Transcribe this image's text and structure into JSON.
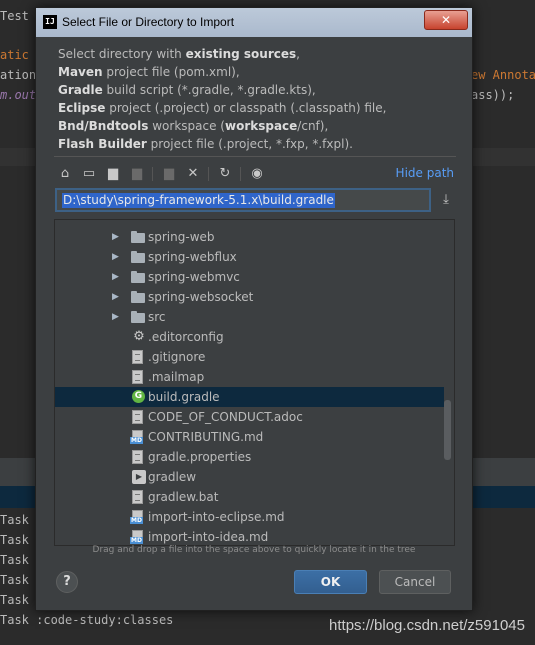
{
  "background": {
    "code_lines": [
      "Test",
      "atic",
      "ation",
      "m.out",
      "ew Annota",
      "ass));"
    ],
    "task_lines": [
      "Task",
      "Task",
      "Task",
      "Task",
      "Task",
      "Task :code-study:classes"
    ],
    "watermark": "https://blog.csdn.net/z591045"
  },
  "dialog": {
    "title": "Select File or Directory to Import",
    "close_label": "✕",
    "description": [
      {
        "bold": "",
        "text": "Select directory with ",
        "bold2": "existing sources",
        "tail": ","
      },
      {
        "bold": "Maven",
        "text": " project file (pom.xml),",
        "bold2": "",
        "tail": ""
      },
      {
        "bold": "Gradle",
        "text": " build script (*.gradle, *.gradle.kts),",
        "bold2": "",
        "tail": ""
      },
      {
        "bold": "Eclipse",
        "text": " project (.project) or classpath (.classpath) file,",
        "bold2": "",
        "tail": ""
      },
      {
        "bold": "Bnd/Bndtools",
        "text": " workspace (",
        "bold2": "workspace",
        "tail": "/cnf),"
      },
      {
        "bold": "Flash Builder",
        "text": " project file (.project, *.fxp, *.fxpl).",
        "bold2": "",
        "tail": ""
      }
    ],
    "toolbar": {
      "hide_path": "Hide path"
    },
    "path_value": "D:\\study\\spring-framework-5.1.x\\build.gradle",
    "tree": [
      {
        "label": "spring-web",
        "type": "folder",
        "expandable": true,
        "selected": false
      },
      {
        "label": "spring-webflux",
        "type": "folder",
        "expandable": true,
        "selected": false
      },
      {
        "label": "spring-webmvc",
        "type": "folder",
        "expandable": true,
        "selected": false
      },
      {
        "label": "spring-websocket",
        "type": "folder",
        "expandable": true,
        "selected": false
      },
      {
        "label": "src",
        "type": "folder",
        "expandable": true,
        "selected": false
      },
      {
        "label": ".editorconfig",
        "type": "config",
        "expandable": false,
        "selected": false
      },
      {
        "label": ".gitignore",
        "type": "file",
        "expandable": false,
        "selected": false
      },
      {
        "label": ".mailmap",
        "type": "file",
        "expandable": false,
        "selected": false
      },
      {
        "label": "build.gradle",
        "type": "gradle",
        "expandable": false,
        "selected": true
      },
      {
        "label": "CODE_OF_CONDUCT.adoc",
        "type": "file",
        "expandable": false,
        "selected": false
      },
      {
        "label": "CONTRIBUTING.md",
        "type": "markdown",
        "expandable": false,
        "selected": false
      },
      {
        "label": "gradle.properties",
        "type": "file",
        "expandable": false,
        "selected": false
      },
      {
        "label": "gradlew",
        "type": "executable",
        "expandable": false,
        "selected": false
      },
      {
        "label": "gradlew.bat",
        "type": "file",
        "expandable": false,
        "selected": false
      },
      {
        "label": "import-into-eclipse.md",
        "type": "markdown",
        "expandable": false,
        "selected": false
      },
      {
        "label": "import-into-idea.md",
        "type": "markdown",
        "expandable": false,
        "selected": false
      }
    ],
    "drag_hint": "Drag and drop a file into the space above to quickly locate it in the tree",
    "help_label": "?",
    "ok_label": "OK",
    "cancel_label": "Cancel"
  },
  "colors": {
    "accent": "#589df6",
    "selection": "#0d293e",
    "dialog_bg": "#3c3f41"
  }
}
